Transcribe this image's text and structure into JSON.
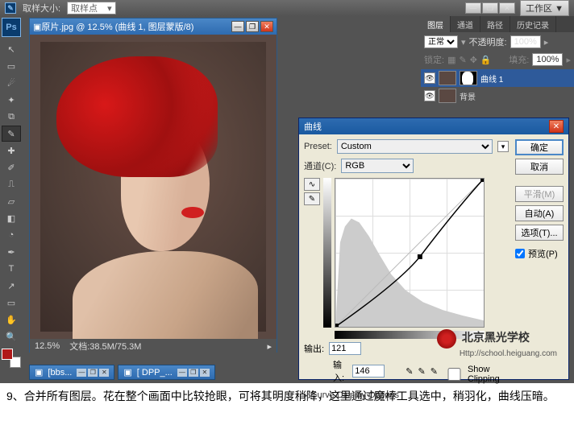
{
  "menubar": {
    "sample_label": "取样大小:",
    "sample_value": "取样点",
    "workspace_label": "工作区 ▼"
  },
  "toolbox": {
    "tools": [
      "↖",
      "▭",
      "✂",
      "✎",
      "◐",
      "✓",
      "✚",
      "✎",
      "⌫",
      "△",
      "T",
      "↘",
      "✋",
      "🔍"
    ]
  },
  "doc": {
    "title": "原片.jpg @ 12.5% (曲线 1, 图层蒙版/8)",
    "zoom": "12.5%",
    "status": "文档:38.5M/75.3M"
  },
  "doc_tabs": [
    {
      "name": "[bbs..."
    },
    {
      "name": "[ DPP_..."
    }
  ],
  "panels": {
    "tabs": [
      "图层",
      "通道",
      "路径",
      "历史记录"
    ],
    "blend": "正常",
    "opacity_label": "不透明度:",
    "opacity": "100%",
    "lock_label": "锁定:",
    "fill_label": "填充:",
    "fill": "100%",
    "layers": [
      {
        "name": "曲线 1",
        "sel": true,
        "mask": true
      },
      {
        "name": "背景",
        "sel": false,
        "mask": false
      }
    ]
  },
  "curves": {
    "title": "曲线",
    "preset_label": "Preset:",
    "preset": "Custom",
    "channel_label": "通道(C):",
    "channel": "RGB",
    "ok": "确定",
    "cancel": "取消",
    "smooth": "平滑(M)",
    "auto": "自动(A)",
    "options": "选项(T)...",
    "preview": "预览(P)",
    "output_label": "输出:",
    "output_value": "121",
    "input_label": "输入:",
    "input_value": "146",
    "show_clipping": "Show Clipping",
    "cdo": "Curve Display Options"
  },
  "watermark": {
    "line1": "北京黑光学校",
    "line2": "Http://school.heiguang.com"
  },
  "chart_data": {
    "type": "line",
    "title": "曲线",
    "xlabel": "输入",
    "ylabel": "输出",
    "xlim": [
      0,
      255
    ],
    "ylim": [
      0,
      255
    ],
    "points": [
      {
        "x": 0,
        "y": 0
      },
      {
        "x": 146,
        "y": 121
      },
      {
        "x": 255,
        "y": 255
      }
    ],
    "histogram_hint": "dark-heavy, peak near 10-40, low tail to 255"
  },
  "caption": "9、合并所有图层。花在整个画面中比较抢眼，可将其明度稍降，这里通过魔棒工具选中，稍羽化，曲线压暗。"
}
